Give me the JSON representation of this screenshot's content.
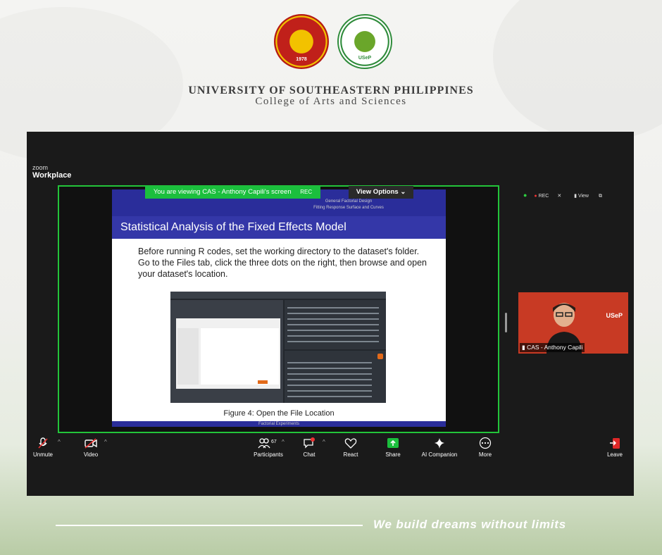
{
  "header": {
    "logos": [
      {
        "name": "usep-seal",
        "text": "UNIVERSITY OF SOUTHEASTERN PHILIPPINES · 1978"
      },
      {
        "name": "cas-seal",
        "text": "COLLEGE OF ARTS AND SCIENCES · USeP"
      }
    ],
    "university": "UNIVERSITY OF SOUTHEASTERN PHILIPPINES",
    "college": "College of Arts and Sciences"
  },
  "zoom": {
    "brand_line1": "zoom",
    "brand_line2": "Workplace",
    "banner": "You are viewing  CAS - Anthony Capili's screen",
    "banner_rec": "REC",
    "view_options": "View Options",
    "status_rec": "REC",
    "status_view": "View",
    "participant_name": "CAS - Anthony Capili",
    "participant_logo": "USeP",
    "participants_count": "67",
    "chat_badge": "1",
    "toolbar": {
      "unmute": "Unmute",
      "video": "Video",
      "participants": "Participants",
      "chat": "Chat",
      "react": "React",
      "share": "Share",
      "ai_companion": "AI Companion",
      "more": "More",
      "leave": "Leave"
    }
  },
  "slide": {
    "header_line1": "General Factorial Design",
    "header_line2": "Fitting Response Surface and Curves",
    "title": "Statistical Analysis of the Fixed Effects Model",
    "body": "Before running R codes, set the working directory to the dataset's folder. Go to the Files tab, click the three dots on the right, then browse and open your dataset's location.",
    "caption": "Figure 4: Open the File Location",
    "footer": "Factorial Experiments"
  },
  "footer": {
    "slogan": "We build dreams without limits"
  },
  "colors": {
    "zoom_green": "#1bbf3d",
    "slide_blue": "#3437a8",
    "tile_red": "#c83a24",
    "usep_red": "#c0201a",
    "cas_green": "#2e8b3a"
  }
}
